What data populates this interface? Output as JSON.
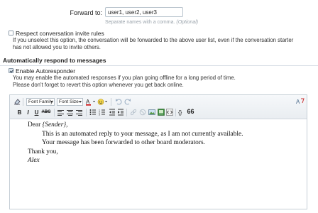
{
  "forward": {
    "label": "Forward to:",
    "value": "user1, user2, user3",
    "hint_text": "Separate names with a comma.",
    "hint_optional": "(Optional)"
  },
  "invite_rules": {
    "label": "Respect conversation invite rules",
    "checked": false,
    "description_1": "If you unselect this option, the conversation will be forwarded to the above user list, even if the conversation starter",
    "description_2": "has not allowed you to invite others."
  },
  "section": {
    "title": "Automatically respond to messages"
  },
  "autoresponder": {
    "label": "Enable Autoresponder",
    "checked": true,
    "description_1": "You may enable the automated responses if you plan going offline for a long period of time.",
    "description_2": "Please don't forget to revert this option whenever you get back online."
  },
  "editor": {
    "font_family": "Font Family",
    "font_size": "Font Size",
    "bold": "B",
    "italic": "I",
    "underline": "U",
    "strikethrough": "ABC",
    "quote": "66",
    "icons": [
      "eraser-icon",
      "text-color-icon",
      "smiley-icon",
      "undo-icon",
      "redo-icon",
      "align-left-icon",
      "align-center-icon",
      "align-right-icon",
      "bullet-list-icon",
      "numbered-list-icon",
      "outdent-icon",
      "indent-icon",
      "link-icon",
      "unlink-icon",
      "image-icon",
      "media-icon",
      "code-icon",
      "quote-icon",
      "switch-mode-icon"
    ],
    "content": {
      "greeting_prefix": "Dear ",
      "greeting_name": "{Sender}",
      "greeting_suffix": ",",
      "line_1": "This is an automated reply to your message, as I am not currently available.",
      "line_2": "Your message has been forwarded to other board moderators.",
      "closing": "Thank you,",
      "signature": "Alex"
    }
  }
}
